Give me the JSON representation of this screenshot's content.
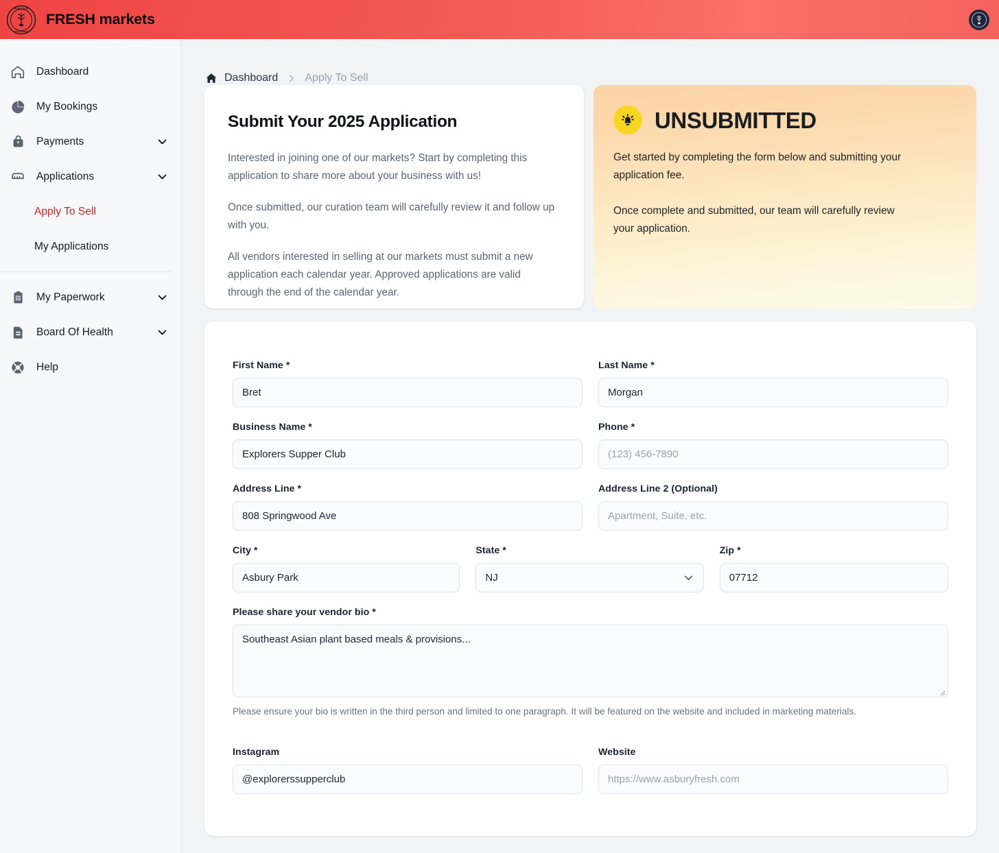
{
  "header": {
    "brand_title": "FRESH markets",
    "logo_icon": "asbury-fresh-circular-logo",
    "avatar_icon": "asbury-fresh-badge-avatar",
    "gradient_from": "#ef4444",
    "gradient_to": "#fb7069"
  },
  "sidebar": {
    "items": [
      {
        "label": "Dashboard",
        "icon": "home-icon",
        "expandable": false
      },
      {
        "label": "My Bookings",
        "icon": "pie-chart-icon",
        "expandable": false
      },
      {
        "label": "Payments",
        "icon": "lock-bag-icon",
        "expandable": true
      },
      {
        "label": "Applications",
        "icon": "stall-awning-icon",
        "expandable": true
      }
    ],
    "sub_items": [
      {
        "label": "Apply To Sell",
        "active": true
      },
      {
        "label": "My Applications",
        "active": false
      }
    ],
    "items_bottom": [
      {
        "label": "My Paperwork",
        "icon": "clipboard-list-icon",
        "expandable": true
      },
      {
        "label": "Board Of Health",
        "icon": "document-icon",
        "expandable": true
      },
      {
        "label": "Help",
        "icon": "lifebuoy-icon",
        "expandable": false
      }
    ],
    "active_color": "#d92020"
  },
  "breadcrumb": {
    "home_icon": "home-icon",
    "link": "Dashboard",
    "separator_icon": "chevron-right-icon",
    "current": "Apply To Sell"
  },
  "intro_card": {
    "title": "Submit Your 2025 Application",
    "paragraphs": [
      "Interested in joining one of our markets? Start by completing this application to share more about your business with us!",
      "Once submitted, our curation team will carefully review it and follow up with you.",
      "All vendors interested in selling at our markets must submit a new application each calendar year. Approved applications are valid through the end of the calendar year."
    ]
  },
  "status_card": {
    "icon": "bell-ringing-icon",
    "icon_bg": "#f8d520",
    "title": "UNSUBMITTED",
    "paragraph_1": "Get started by completing the form below and submitting your application fee.",
    "paragraph_2": "Once complete and submitted, our team will carefully review your application."
  },
  "form": {
    "first_name": {
      "label": "First Name *",
      "value": "Bret"
    },
    "last_name": {
      "label": "Last Name *",
      "value": "Morgan"
    },
    "business_name": {
      "label": "Business Name *",
      "value": "Explorers Supper Club"
    },
    "phone": {
      "label": "Phone *",
      "value": "",
      "placeholder": "(123) 456-7890"
    },
    "address_line": {
      "label": "Address Line *",
      "value": "808 Springwood Ave"
    },
    "address_line_2": {
      "label": "Address Line 2 (Optional)",
      "value": "",
      "placeholder": "Apartment, Suite, etc."
    },
    "city": {
      "label": "City *",
      "value": "Asbury Park"
    },
    "state": {
      "label": "State *",
      "value": "NJ",
      "chevron_icon": "chevron-down-icon"
    },
    "zip": {
      "label": "Zip *",
      "value": "07712"
    },
    "bio": {
      "label": "Please share your vendor bio *",
      "value": "Southeast Asian plant based meals & provisions...",
      "help": "Please ensure your bio is written in the third person and limited to one paragraph. It will be featured on the website and included in marketing materials."
    },
    "instagram": {
      "label": "Instagram",
      "value": "@explorerssupperclub"
    },
    "website": {
      "label": "Website",
      "value": "",
      "placeholder": "https://www.asburyfresh.com"
    }
  }
}
